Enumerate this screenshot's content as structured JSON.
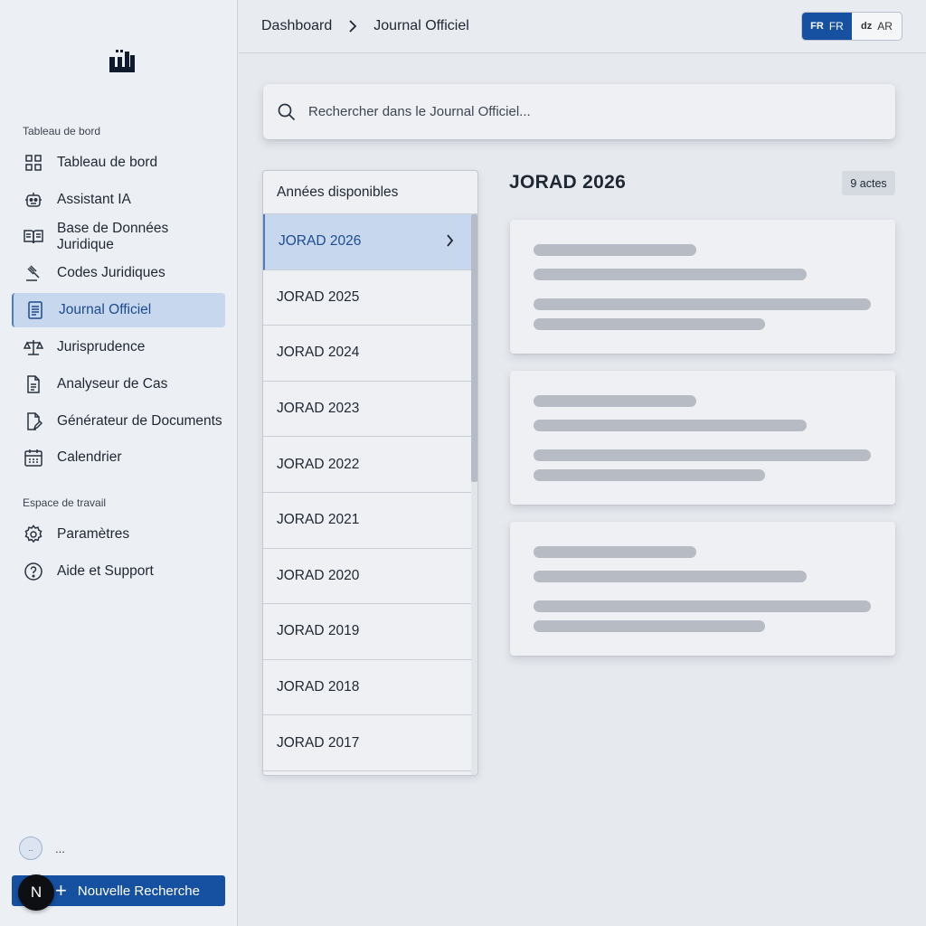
{
  "sidebar": {
    "logo_icon": "app-logo-icon",
    "sections": [
      {
        "label": "Tableau de bord",
        "items": [
          {
            "label": "Tableau de bord",
            "icon": "grid-icon"
          },
          {
            "label": "Assistant IA",
            "icon": "robot-icon"
          },
          {
            "label": "Base de Données Juridique",
            "icon": "book-icon"
          },
          {
            "label": "Codes Juridiques",
            "icon": "gavel-icon"
          },
          {
            "label": "Journal Officiel",
            "icon": "journal-icon",
            "active": true
          },
          {
            "label": "Jurisprudence",
            "icon": "scales-icon"
          },
          {
            "label": "Analyseur de Cas",
            "icon": "document-icon"
          },
          {
            "label": "Générateur de Documents",
            "icon": "document-edit-icon"
          },
          {
            "label": "Calendrier",
            "icon": "calendar-icon"
          }
        ]
      },
      {
        "label": "Espace de travail",
        "items": [
          {
            "label": "Paramètres",
            "icon": "gear-icon"
          },
          {
            "label": "Aide et Support",
            "icon": "help-icon"
          }
        ]
      }
    ],
    "user": {
      "avatar_text": "..",
      "name": "..."
    },
    "new_search_label": "Nouvelle Recherche",
    "floating_badge": "N"
  },
  "header": {
    "breadcrumb": [
      "Dashboard",
      "Journal Officiel"
    ],
    "languages": [
      {
        "code": "FR",
        "label": "FR",
        "active": true
      },
      {
        "code": "dz",
        "label": "AR",
        "active": false
      }
    ]
  },
  "search": {
    "placeholder": "Rechercher dans le Journal Officiel..."
  },
  "years_panel": {
    "heading": "Années disponibles",
    "years": [
      "JORAD 2026",
      "JORAD 2025",
      "JORAD 2024",
      "JORAD 2023",
      "JORAD 2022",
      "JORAD 2021",
      "JORAD 2020",
      "JORAD 2019",
      "JORAD 2018",
      "JORAD 2017"
    ],
    "selected": "JORAD 2026"
  },
  "detail": {
    "title": "JORAD 2026",
    "count_label": "9 actes",
    "loading_cards": 3
  },
  "colors": {
    "accent": "#1550a1",
    "active_bg": "#c7d8ee",
    "active_text": "#1d4b8f",
    "skeleton": "#b7bcc4"
  }
}
